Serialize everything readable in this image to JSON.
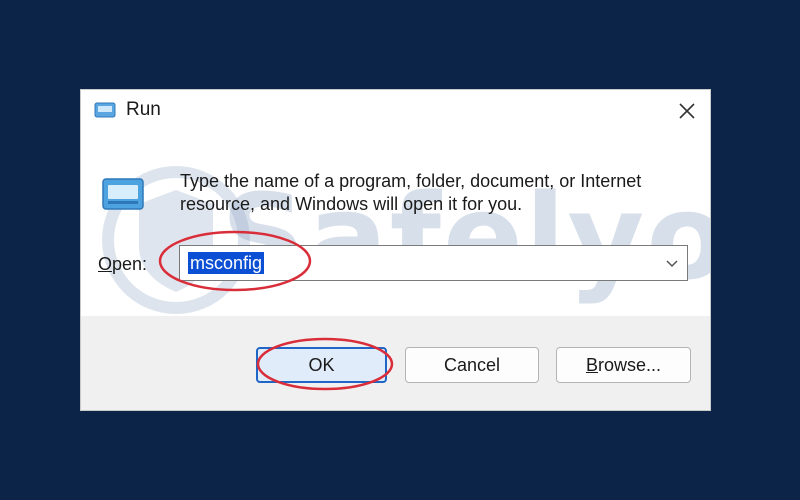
{
  "window": {
    "title": "Run",
    "close_icon": "close-icon"
  },
  "watermark": {
    "text": "Safelyo"
  },
  "instructions": "Type the name of a program, folder, document, or Internet resource, and Windows will open it for you.",
  "open_field": {
    "label_access_key": "O",
    "label_rest": "pen:",
    "value": "msconfig"
  },
  "buttons": {
    "ok": "OK",
    "cancel": "Cancel",
    "browse_access_key": "B",
    "browse_rest": "rowse..."
  },
  "colors": {
    "background": "#0b2447",
    "selection": "#0a4fd4",
    "annotation": "#d92d3a"
  }
}
